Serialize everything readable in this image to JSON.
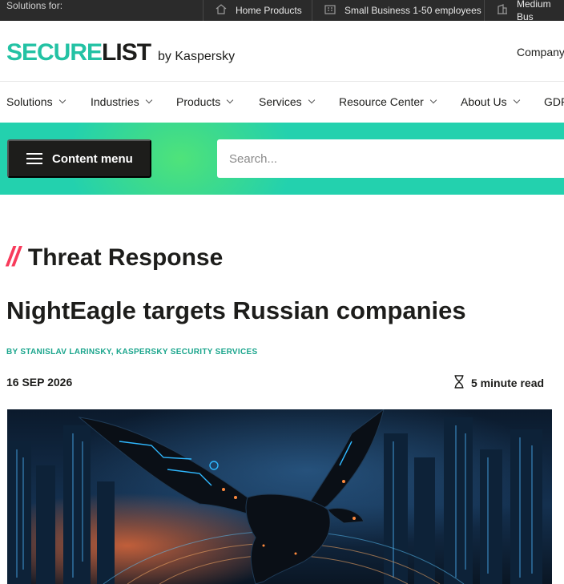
{
  "topbar": {
    "lead": "Solutions for:",
    "segments": [
      {
        "icon": "home-icon",
        "label": "Home Products"
      },
      {
        "icon": "small-business-icon",
        "label": "Small Business 1-50 employees"
      },
      {
        "icon": "medium-business-icon",
        "label": "Medium Bus"
      }
    ]
  },
  "logo": {
    "secure": "SECURE",
    "list": "LIST",
    "by": "by Kaspersky"
  },
  "header": {
    "company": "Company"
  },
  "nav": {
    "items": [
      "Solutions",
      "Industries",
      "Products",
      "Services",
      "Resource Center",
      "About Us",
      "GDP"
    ]
  },
  "toolbar": {
    "content_menu": "Content menu",
    "search_placeholder": "Search..."
  },
  "article": {
    "category_mark": "//",
    "category": "Threat Response",
    "title": "NightEagle targets Russian companies",
    "byline_prefix": "BY ",
    "author": "STANISLAV LARINSKY",
    "byline_sep": ", ",
    "author_org": "KASPERSKY SECURITY SERVICES",
    "date": "16 SEP 2026",
    "read_time": "5 minute read"
  },
  "colors": {
    "accent": "#23d1ae",
    "brand_green": "#23c2a4",
    "category_slash": "#f83b5b",
    "dark": "#1d1d1b"
  }
}
